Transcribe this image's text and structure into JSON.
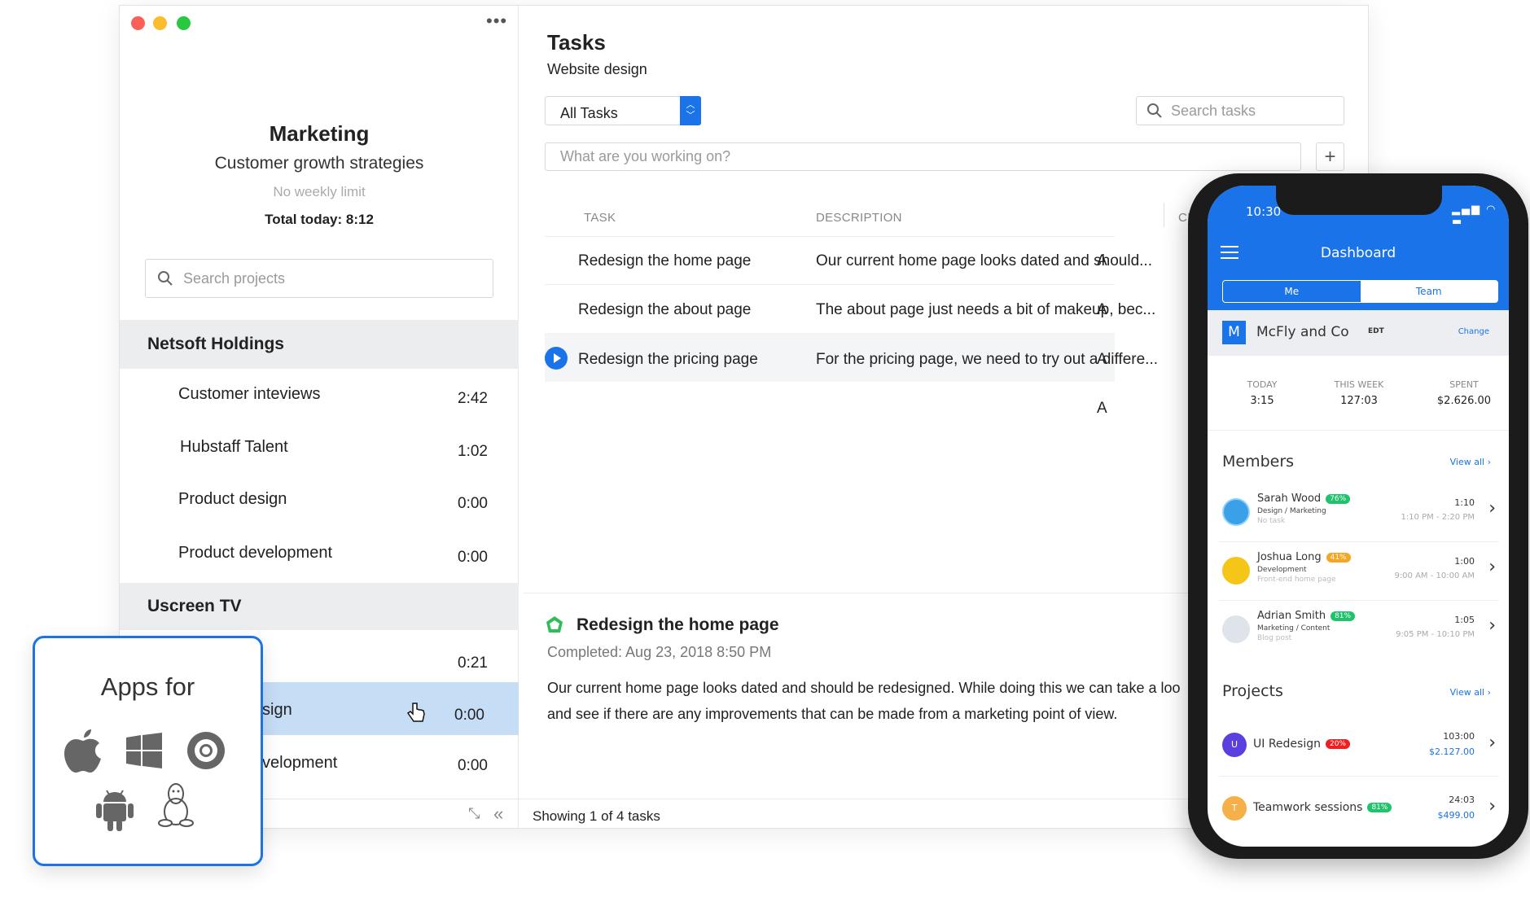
{
  "sidebar": {
    "menu_icon": "more-dots-icon",
    "project_title": "Marketing",
    "project_subtitle": "Customer growth strategies",
    "weekly_limit": "No weekly limit",
    "total_today": "Total today: 8:12",
    "search_placeholder": "Search projects",
    "groups": [
      {
        "name": "Netsoft Holdings",
        "items": [
          {
            "label": "Customer inteviews",
            "time": "2:42"
          },
          {
            "label": "Hubstaff Talent",
            "time": "1:02"
          },
          {
            "label": "Product design",
            "time": "0:00"
          },
          {
            "label": "Product development",
            "time": "0:00"
          }
        ]
      },
      {
        "name": "Uscreen TV",
        "items": [
          {
            "label": "",
            "time": "0:21"
          },
          {
            "label": "sign",
            "time": "0:00"
          },
          {
            "label": "velopment",
            "time": "0:00"
          }
        ]
      }
    ]
  },
  "main": {
    "title": "Tasks",
    "subtitle": "Website design",
    "filter": "All Tasks",
    "search_placeholder": "Search tasks",
    "new_task_placeholder": "What are you working on?",
    "add_label": "+",
    "columns": [
      "TASK",
      "DESCRIPTION",
      "CR"
    ],
    "rows": [
      {
        "task": "Redesign the home page",
        "description": "Our current home page looks dated and should...",
        "extra": "A"
      },
      {
        "task": "Redesign the about page",
        "description": "The about page just needs a bit of makeup, bec...",
        "extra": "A"
      },
      {
        "task": "Redesign the pricing page",
        "description": "For the pricing page, we need to try out a differe...",
        "extra": "A"
      },
      {
        "task": "",
        "description": "",
        "extra": "A"
      }
    ],
    "detail": {
      "title": "Redesign the home page",
      "completed": "Completed: Aug 23, 2018 8:50 PM",
      "line1": "Our current home page looks dated and should be redesigned. While doing this we can take a loo",
      "line2": "and see if there are any improvements that can be made from a marketing point of view."
    },
    "footer": "Showing 1 of 4 tasks"
  },
  "apps": {
    "title": "Apps for",
    "icons": [
      "apple-icon",
      "windows-icon",
      "chrome-icon",
      "android-icon",
      "linux-icon"
    ]
  },
  "phone": {
    "time": "10:30",
    "title": "Dashboard",
    "seg_me": "Me",
    "seg_team": "Team",
    "org_letter": "M",
    "org_name": "McFly and Co",
    "org_tz": "EDT",
    "change": "Change",
    "stats": [
      {
        "label": "TODAY",
        "value": "3:15"
      },
      {
        "label": "THIS WEEK",
        "value": "127:03"
      },
      {
        "label": "SPENT",
        "value": "$2.626.00"
      }
    ],
    "members_title": "Members",
    "view_all": "View all",
    "members": [
      {
        "name": "Sarah Wood",
        "badge": "76%",
        "role": "Design / Marketing",
        "task": "No task",
        "time": "1:10",
        "range": "1:10 PM - 2:20 PM"
      },
      {
        "name": "Joshua Long",
        "badge": "41%",
        "role": "Development",
        "task": "Front-end home page",
        "time": "1:00",
        "range": "9:00 AM - 10:00 AM"
      },
      {
        "name": "Adrian Smith",
        "badge": "81%",
        "role": "Marketing / Content",
        "task": "Blog post",
        "time": "1:05",
        "range": "9:05 PM - 10:10 PM"
      }
    ],
    "projects_title": "Projects",
    "projects": [
      {
        "letter": "U",
        "name": "UI Redesign",
        "badge": "20%",
        "hours": "103:00",
        "amount": "$2.127.00"
      },
      {
        "letter": "T",
        "name": "Teamwork sessions",
        "badge": "81%",
        "hours": "24:03",
        "amount": "$499.00"
      }
    ]
  },
  "colors": {
    "accent": "#1a73e8",
    "green": "#1fc36b",
    "orange": "#f5a623",
    "red": "#f01e1e",
    "purple": "#5b3fe0"
  }
}
